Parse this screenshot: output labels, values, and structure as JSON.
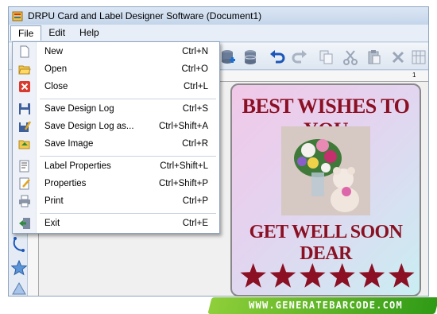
{
  "window": {
    "title": "DRPU Card and Label Designer Software  (Document1)"
  },
  "menubar": {
    "items": [
      {
        "label": "File",
        "active": true
      },
      {
        "label": "Edit",
        "active": false
      },
      {
        "label": "Help",
        "active": false
      }
    ]
  },
  "file_menu": {
    "items": [
      {
        "label": "New",
        "shortcut": "Ctrl+N",
        "icon": "new-document-icon"
      },
      {
        "label": "Open",
        "shortcut": "Ctrl+O",
        "icon": "open-folder-icon"
      },
      {
        "label": "Close",
        "shortcut": "Ctrl+L",
        "icon": "close-icon"
      },
      {
        "label": "Save Design Log",
        "shortcut": "Ctrl+S",
        "icon": "save-icon"
      },
      {
        "label": "Save Design Log as...",
        "shortcut": "Ctrl+Shift+A",
        "icon": "save-as-icon"
      },
      {
        "label": "Save Image",
        "shortcut": "Ctrl+R",
        "icon": "save-image-icon"
      },
      {
        "label": "Label Properties",
        "shortcut": "Ctrl+Shift+L",
        "icon": "label-properties-icon"
      },
      {
        "label": "Properties",
        "shortcut": "Ctrl+Shift+P",
        "icon": "properties-icon"
      },
      {
        "label": "Print",
        "shortcut": "Ctrl+P",
        "icon": "printer-icon"
      },
      {
        "label": "Exit",
        "shortcut": "Ctrl+E",
        "icon": "exit-icon"
      }
    ]
  },
  "toolbar": {
    "icons": [
      "database-add-icon",
      "database-icon",
      "undo-icon",
      "redo-icon",
      "copy-icon",
      "cut-icon",
      "paste-icon",
      "delete-icon",
      "grid-icon"
    ]
  },
  "ruler": {
    "tick_label": "1"
  },
  "card": {
    "headline": "BEST WISHES TO YOU",
    "subline": "GET WELL SOON DEAR",
    "star_count": 6,
    "text_color": "#8b1023"
  },
  "footer": {
    "url": "WWW.GENERATEBARCODE.COM"
  }
}
